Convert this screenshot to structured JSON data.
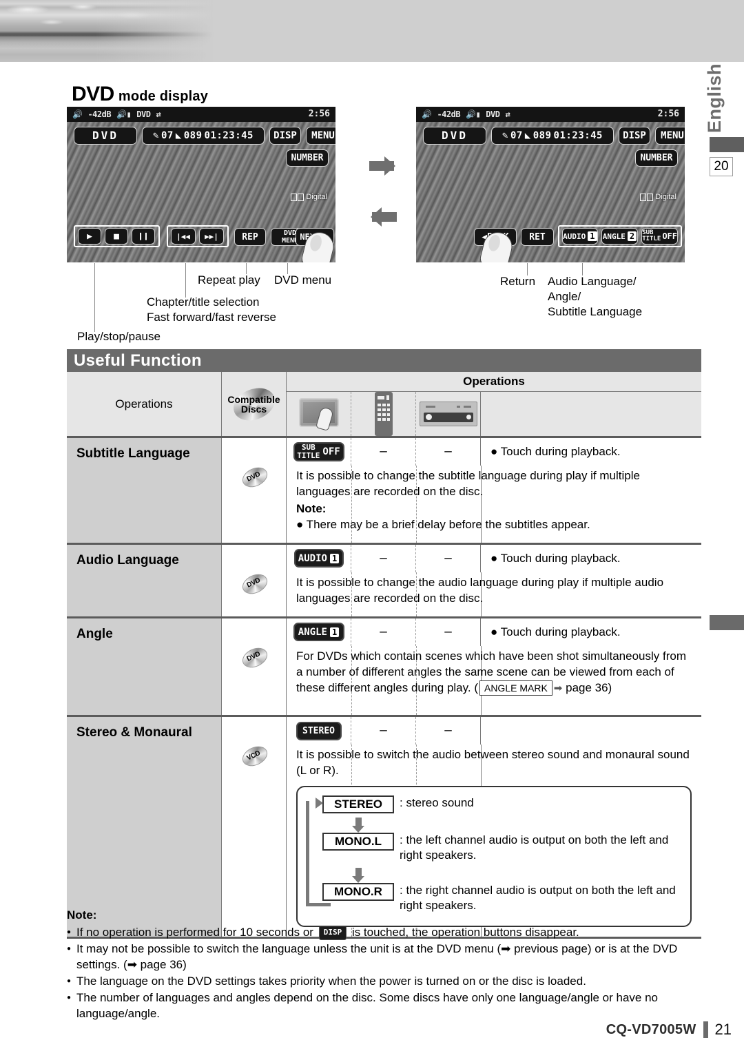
{
  "page": {
    "side_language_tab": "English",
    "side_page_ref": "20",
    "footer_model": "CQ-VD7005W",
    "footer_page": "21"
  },
  "section": {
    "heading_bold": "DVD",
    "heading_rest": "mode display"
  },
  "lcd_left": {
    "status": {
      "volume": "-42dB",
      "source": "DVD",
      "time": "2:56"
    },
    "source_button": "DVD",
    "info": {
      "chapter": "07",
      "title": "089",
      "elapsed": "01:23:45"
    },
    "disp_button": "DISP",
    "menu_button": "MENU",
    "number_button": "NUMBER",
    "dolby_label": "Digital",
    "controls": {
      "play": "▶",
      "stop": "■",
      "pause": "❙❙",
      "prev": "|◀◀",
      "next_track": "▶▶|",
      "rep": "REP",
      "dvd_menu_line1": "DVD",
      "dvd_menu_line2": "MENU",
      "next": "NEXT ▶"
    }
  },
  "lcd_right": {
    "status": {
      "volume": "-42dB",
      "source": "DVD",
      "time": "2:56"
    },
    "source_button": "DVD",
    "info": {
      "chapter": "07",
      "title": "089",
      "elapsed": "01:23:45"
    },
    "disp_button": "DISP",
    "menu_button": "MENU",
    "number_button": "NUMBER",
    "dolby_label": "Digital",
    "controls": {
      "back": "◀BACK",
      "ret": "RET",
      "audio_label": "AUDIO",
      "audio_value": "1",
      "angle_label": "ANGLE",
      "angle_value": "2",
      "subtitle_line1": "SUB",
      "subtitle_line2": "TITLE",
      "subtitle_value": "OFF"
    }
  },
  "callouts": {
    "left": [
      "Repeat play",
      "DVD menu",
      "Chapter/title selection",
      "Fast forward/fast reverse",
      "Play/stop/pause"
    ],
    "right": [
      "Return",
      "Audio Language/",
      "Angle/",
      "Subtitle Language"
    ]
  },
  "useful_function": {
    "title": "Useful Function",
    "header": {
      "col_operations": "Operations",
      "col_compatible_line1": "Compatible",
      "col_compatible_line2": "Discs",
      "col_operations_group": "Operations",
      "icons": [
        "touch-panel-icon",
        "remote-control-icon",
        "head-unit-icon"
      ]
    },
    "rows": [
      {
        "name": "Subtitle Language",
        "disc": "DVD",
        "button": {
          "kind": "subtitle",
          "line1": "SUB",
          "line2": "TITLE",
          "value": "OFF"
        },
        "remote": "–",
        "unit": "–",
        "note": "● Touch during playback.",
        "desc": "It is possible to change the subtitle language during play if multiple languages are recorded on the disc.",
        "sub_note_label": "Note:",
        "sub_note": "● There may be a brief delay before the subtitles appear."
      },
      {
        "name": "Audio Language",
        "disc": "DVD",
        "button": {
          "kind": "audio",
          "label": "AUDIO",
          "value": "1"
        },
        "remote": "–",
        "unit": "–",
        "note": "● Touch during playback.",
        "desc": "It is possible to change the audio language during play if multiple audio languages are recorded on the disc."
      },
      {
        "name": "Angle",
        "disc": "DVD",
        "button": {
          "kind": "angle",
          "label": "ANGLE",
          "value": "1"
        },
        "remote": "–",
        "unit": "–",
        "note": "● Touch during playback.",
        "desc_part1": "For DVDs which contain scenes which have been shot simultaneously from a number of different angles the same scene can be viewed from each of these different angles during play. (",
        "desc_key": "ANGLE MARK",
        "desc_part2": "page 36)"
      },
      {
        "name": "Stereo & Monaural",
        "disc": "VCD",
        "button": {
          "kind": "stereo",
          "label": "STEREO"
        },
        "remote": "–",
        "unit": "–",
        "note": "",
        "desc": "It is possible to switch the audio between stereo sound and monaural sound (L or R).",
        "flow": [
          {
            "key": "STEREO",
            "text": ": stereo sound"
          },
          {
            "key": "MONO.L",
            "text": ": the left channel audio is output on both the left and right speakers."
          },
          {
            "key": "MONO.R",
            "text": ": the right channel audio is output on both the left and right speakers."
          }
        ]
      }
    ]
  },
  "notes": {
    "label": "Note:",
    "items": [
      {
        "pre": "If no operation is performed for 10 seconds or ",
        "key": "DISP",
        "post": " is touched, the operation buttons disappear."
      },
      {
        "pre": "It may not be possible to switch the language unless the unit is at the DVD menu (➡ previous page) or is at the DVD settings. (➡ page 36)",
        "key": "",
        "post": ""
      },
      {
        "pre": "The language on the DVD settings takes priority when the power is turned on or the disc is loaded.",
        "key": "",
        "post": ""
      },
      {
        "pre": "The number of languages and angles depend on the disc. Some discs have only one language/angle or have no language/angle.",
        "key": "",
        "post": ""
      }
    ]
  },
  "colors": {
    "bar_gray": "#6b6b6b",
    "row_name_gray": "#cfcfcf",
    "header_gray": "#e6e6e6",
    "lcd_black": "#151515"
  }
}
